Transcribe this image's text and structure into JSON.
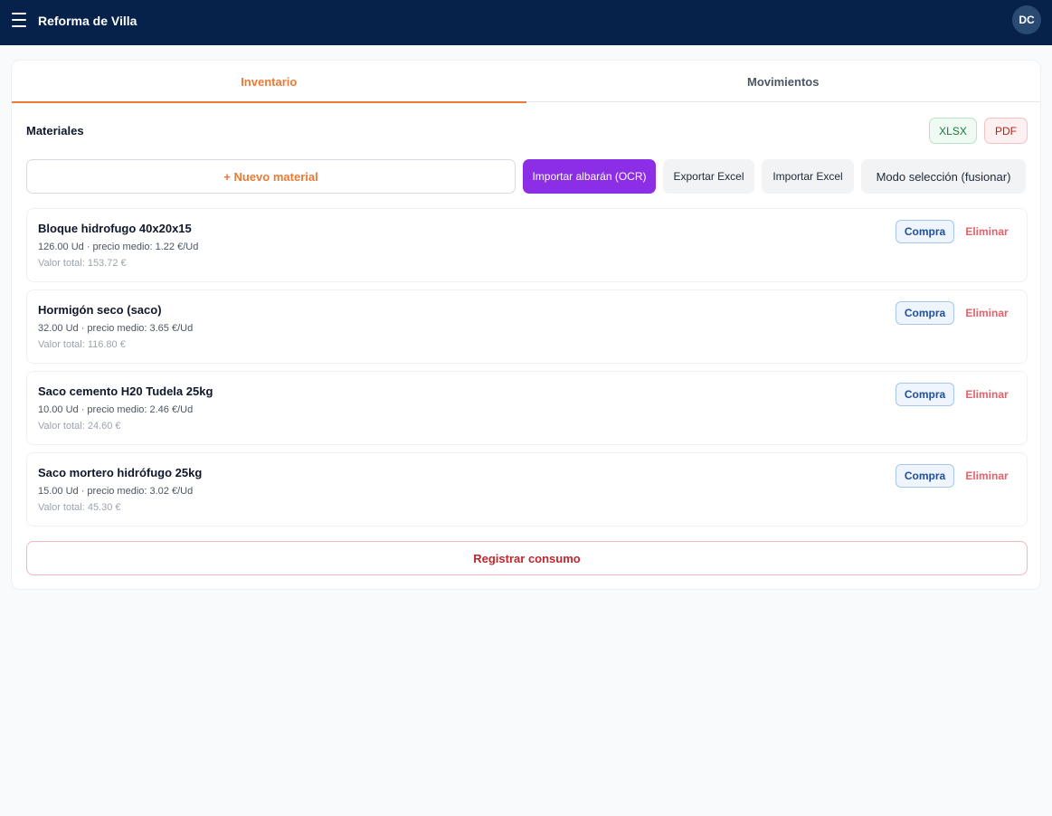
{
  "header": {
    "app_title": "Reforma de Villa",
    "avatar_initials": "DC",
    "menu_icon": "hamburger-menu-icon"
  },
  "tabs": [
    {
      "label": "Inventario",
      "active": true
    },
    {
      "label": "Movimientos",
      "active": false
    }
  ],
  "materials": {
    "title": "Materiales",
    "export_xlsx_label": "XLSX",
    "export_pdf_label": "PDF",
    "actions": {
      "new_material_label": "+ Nuevo material",
      "import_ocr_label": "Importar albarán (OCR)",
      "export_excel_label": "Exportar Excel",
      "import_excel_label": "Importar Excel",
      "selection_mode_label": "Modo selección (fusionar)"
    },
    "items": [
      {
        "name": "Bloque hidrofugo 40x20x15",
        "quantity_line": "126.00 Ud · precio medio: 1.22 €/Ud",
        "total_line": "Valor total: 153.72 €",
        "buy_label": "Compra",
        "delete_label": "Eliminar"
      },
      {
        "name": "Hormigón seco (saco)",
        "quantity_line": "32.00 Ud · precio medio: 3.65 €/Ud",
        "total_line": "Valor total: 116.80 €",
        "buy_label": "Compra",
        "delete_label": "Eliminar"
      },
      {
        "name": "Saco cemento H20 Tudela 25kg",
        "quantity_line": "10.00 Ud · precio medio: 2.46 €/Ud",
        "total_line": "Valor total: 24.60 €",
        "buy_label": "Compra",
        "delete_label": "Eliminar"
      },
      {
        "name": "Saco mortero hidrófugo 25kg",
        "quantity_line": "15.00 Ud · precio medio: 3.02 €/Ud",
        "total_line": "Valor total: 45.30 €",
        "buy_label": "Compra",
        "delete_label": "Eliminar"
      }
    ],
    "register_consumption_label": "Registrar consumo"
  },
  "colors": {
    "header_bg": "#06224b",
    "accent_orange": "#ea7a36",
    "ocr_purple": "#8b2ee6",
    "danger_red": "#c0262d",
    "buy_blue": "#1e4fa0"
  }
}
